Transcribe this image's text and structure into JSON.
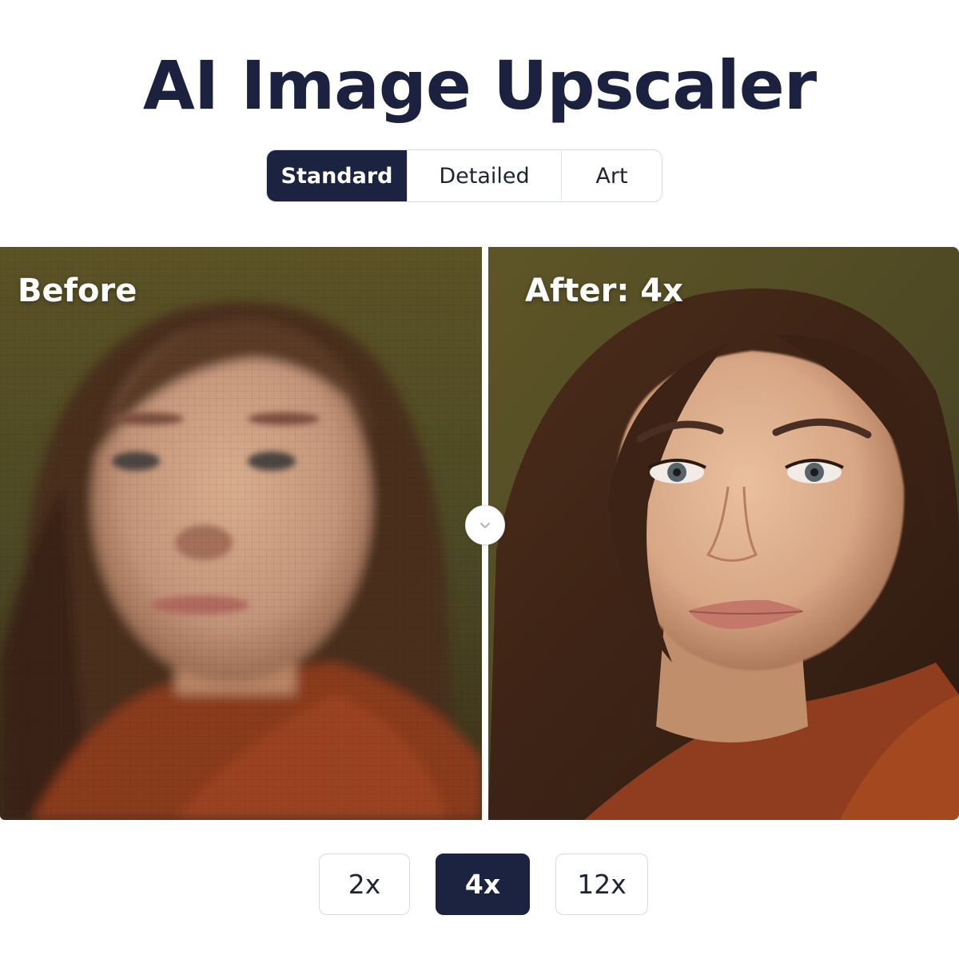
{
  "title": "AI Image Upscaler",
  "modes": [
    {
      "label": "Standard",
      "active": true
    },
    {
      "label": "Detailed",
      "active": false
    },
    {
      "label": "Art",
      "active": false
    }
  ],
  "compare": {
    "before_label": "Before",
    "after_label": "After: 4x",
    "handle_icon": "chevron-down-icon"
  },
  "scales": [
    {
      "label": "2x",
      "active": false
    },
    {
      "label": "4x",
      "active": true
    },
    {
      "label": "12x",
      "active": false
    }
  ],
  "colors": {
    "accent": "#1c2340",
    "border": "#d9dbe3",
    "background": "#ffffff"
  }
}
